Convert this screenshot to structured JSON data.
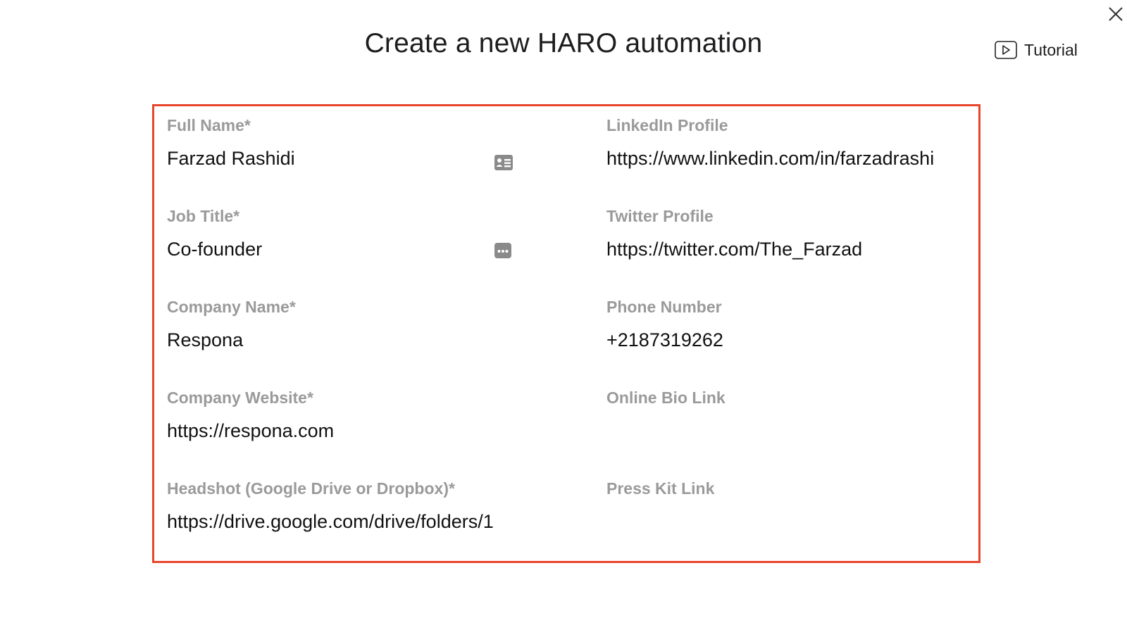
{
  "header": {
    "title": "Create a new HARO automation",
    "tutorial_label": "Tutorial"
  },
  "icons": {
    "close": "close-icon",
    "tutorial": "play-icon",
    "contact": "contact-card-icon",
    "more": "more-options-icon"
  },
  "colors": {
    "highlight_border": "#e8452c",
    "label": "#9a9a9a",
    "text": "#111111"
  },
  "form": {
    "full_name": {
      "label": "Full Name*",
      "value": "Farzad Rashidi"
    },
    "job_title": {
      "label": "Job Title*",
      "value": "Co-founder"
    },
    "company_name": {
      "label": "Company Name*",
      "value": "Respona"
    },
    "company_website": {
      "label": "Company Website*",
      "value": "https://respona.com"
    },
    "headshot": {
      "label": "Headshot (Google Drive or Dropbox)*",
      "value": "https://drive.google.com/drive/folders/1"
    },
    "linkedin": {
      "label": "LinkedIn Profile",
      "value": "https://www.linkedin.com/in/farzadrashi"
    },
    "twitter": {
      "label": "Twitter Profile",
      "value": "https://twitter.com/The_Farzad"
    },
    "phone": {
      "label": "Phone Number",
      "value": "+2187319262"
    },
    "bio_link": {
      "label": "Online Bio Link",
      "value": ""
    },
    "press_kit": {
      "label": "Press Kit Link",
      "value": ""
    }
  }
}
